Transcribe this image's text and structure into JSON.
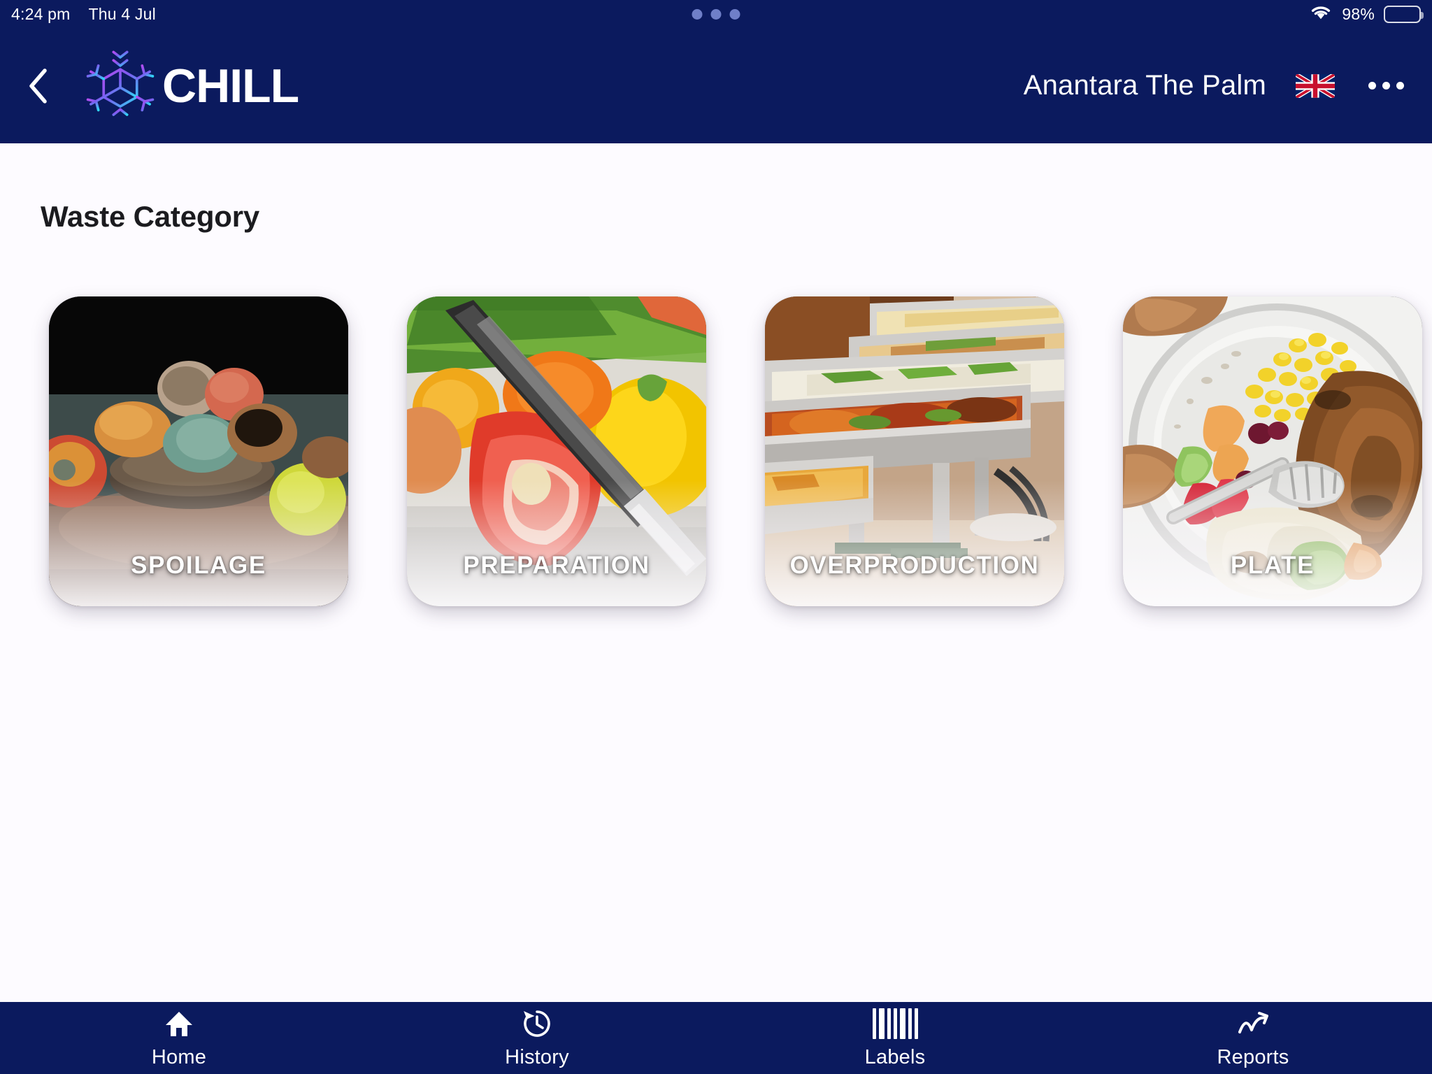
{
  "status_bar": {
    "time": "4:24 pm",
    "date": "Thu 4 Jul",
    "battery_percent": "98%",
    "wifi_icon": "wifi-icon",
    "battery_icon": "battery-icon",
    "center_indicator_icon": "three-dots-indicator"
  },
  "header": {
    "back_icon": "chevron-left-icon",
    "logo_icon": "snowflake-cube-logo-icon",
    "brand_name": "CHILL",
    "hotel_name": "Anantara The Palm",
    "flag_icon": "uk-flag-icon",
    "more_icon": "kebab-menu-icon",
    "background_color": "#0b1a5e"
  },
  "main": {
    "page_title": "Waste Category",
    "categories": [
      {
        "label": "SPOILAGE",
        "image_name": "spoiled-fruit-on-wood-image"
      },
      {
        "label": "PREPARATION",
        "image_name": "knife-cutting-peppers-image"
      },
      {
        "label": "OVERPRODUCTION",
        "image_name": "buffet-chafing-dishes-image"
      },
      {
        "label": "PLATE",
        "image_name": "leftover-food-plate-image"
      }
    ]
  },
  "bottom_nav": {
    "items": [
      {
        "label": "Home",
        "icon": "home-icon"
      },
      {
        "label": "History",
        "icon": "history-clock-icon"
      },
      {
        "label": "Labels",
        "icon": "barcode-icon"
      },
      {
        "label": "Reports",
        "icon": "trend-chart-icon"
      }
    ]
  },
  "colors": {
    "navy": "#0b1a5e",
    "page_background": "#fdfbff",
    "logo_gradient_start": "#a855f7",
    "logo_gradient_end": "#22d3ee"
  }
}
